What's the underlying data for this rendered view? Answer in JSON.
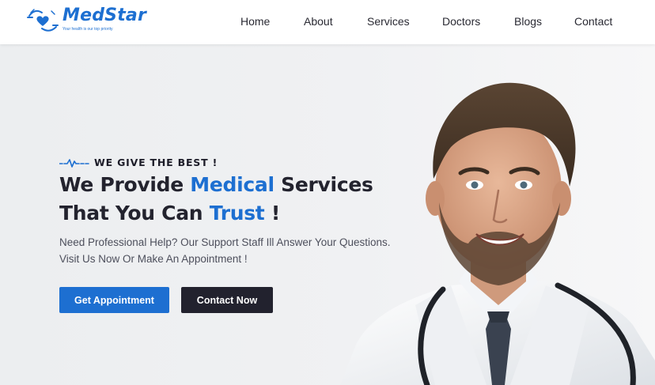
{
  "brand": {
    "name": "MedStar",
    "tagline": "Your health is our top priority"
  },
  "nav": {
    "items": [
      {
        "label": "Home"
      },
      {
        "label": "About"
      },
      {
        "label": "Services"
      },
      {
        "label": "Doctors"
      },
      {
        "label": "Blogs"
      },
      {
        "label": "Contact"
      }
    ]
  },
  "hero": {
    "eyebrow": "WE GIVE THE BEST !",
    "headline": {
      "line1_a": "We Provide ",
      "line1_accent": "Medical",
      "line1_b": " Services",
      "line2_a": "That You Can ",
      "line2_accent": "Trust",
      "line2_b": " !"
    },
    "subtext_line1": "Need Professional Help? Our Support Staff Ill Answer Your Questions.",
    "subtext_line2": "Visit Us Now Or Make An Appointment !",
    "primary_button": "Get Appointment",
    "secondary_button": "Contact Now"
  },
  "colors": {
    "accent": "#1d6fd1",
    "dark": "#22222e",
    "text": "#23232e"
  },
  "icons": {
    "logo": "hands-heart-icon",
    "eyebrow": "heartbeat-pulse-icon"
  }
}
